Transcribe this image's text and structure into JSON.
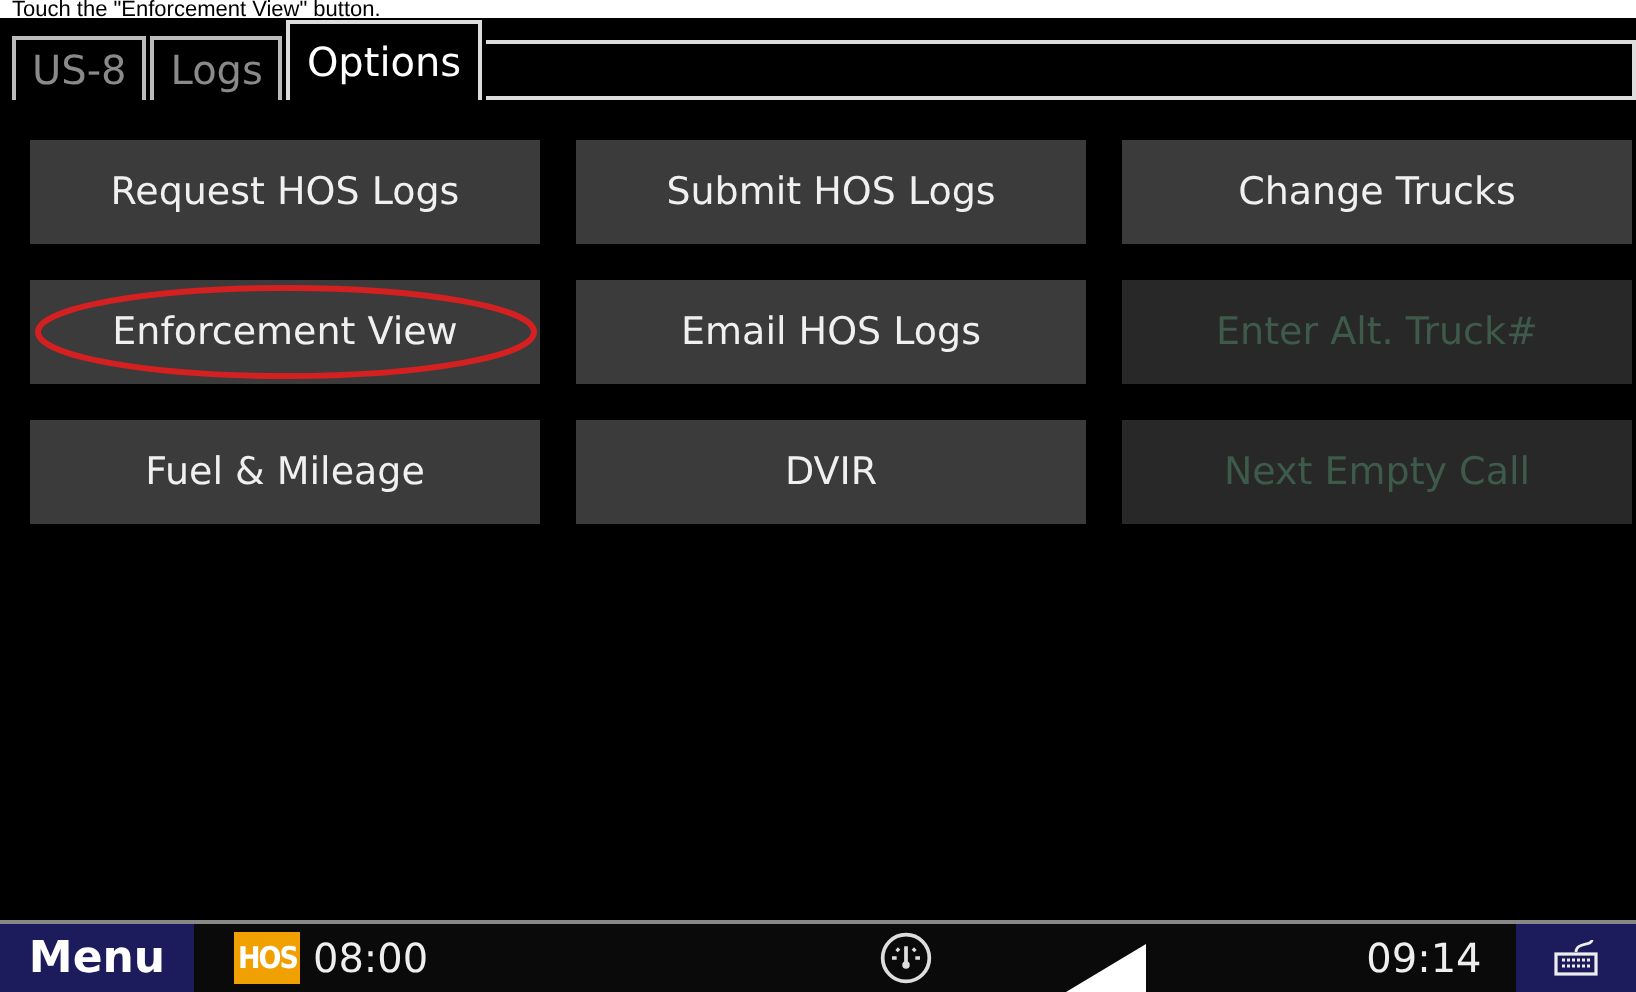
{
  "caption": "Touch the \"Enforcement View\" button.",
  "tabs": [
    {
      "label": "US-8",
      "selected": false
    },
    {
      "label": "Logs",
      "selected": false
    },
    {
      "label": "Options",
      "selected": true
    }
  ],
  "buttons": [
    {
      "label": "Request HOS Logs",
      "disabled": false,
      "highlighted": false
    },
    {
      "label": "Submit HOS Logs",
      "disabled": false,
      "highlighted": false
    },
    {
      "label": "Change Trucks",
      "disabled": false,
      "highlighted": false
    },
    {
      "label": "Enforcement View",
      "disabled": false,
      "highlighted": true
    },
    {
      "label": "Email HOS Logs",
      "disabled": false,
      "highlighted": false
    },
    {
      "label": "Enter Alt. Truck#",
      "disabled": true,
      "highlighted": false
    },
    {
      "label": "Fuel & Mileage",
      "disabled": false,
      "highlighted": false
    },
    {
      "label": "DVIR",
      "disabled": false,
      "highlighted": false
    },
    {
      "label": "Next Empty Call",
      "disabled": true,
      "highlighted": false
    }
  ],
  "status_bar": {
    "menu": "Menu",
    "hos_badge": "HOS",
    "hos_time": "08:00",
    "clock": "09:14"
  }
}
